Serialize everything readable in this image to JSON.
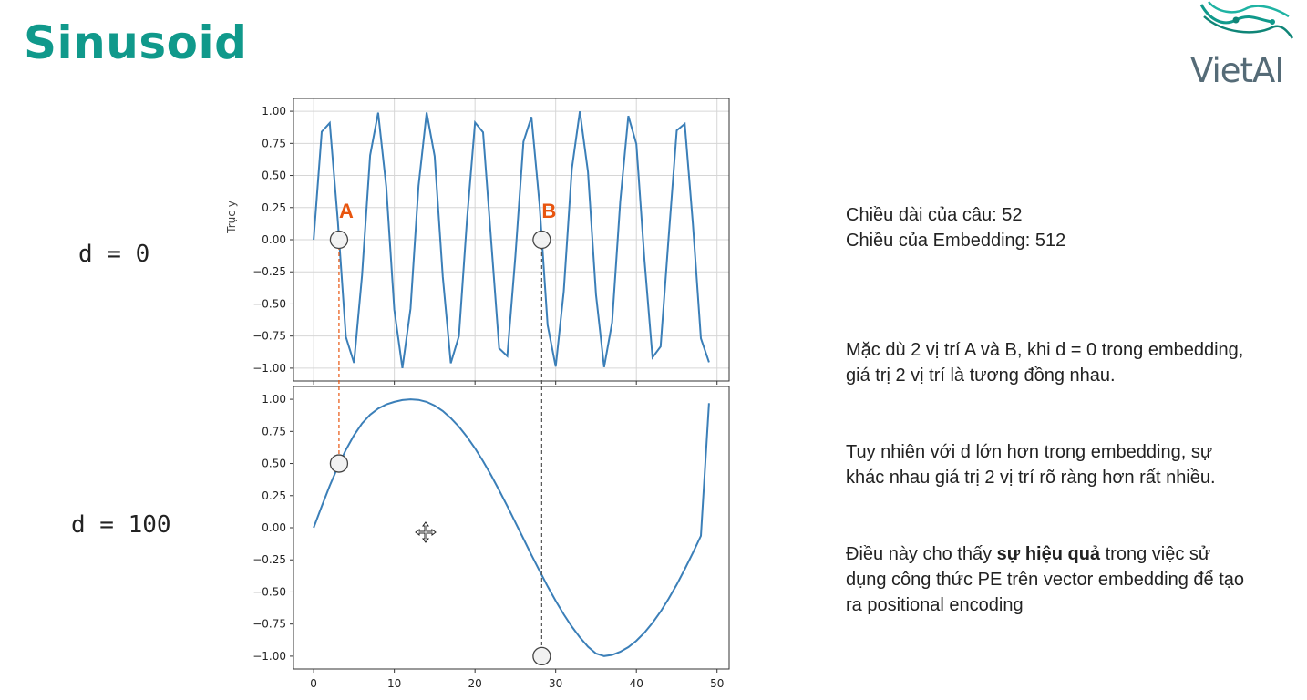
{
  "slide": {
    "title": "Sinusoid",
    "logo_text": "VietAI",
    "d_labels": [
      "d = 0",
      "d = 100"
    ],
    "accent_color": "#10998b",
    "marker_color": "#e8550f",
    "line_color": "#3b7fb8"
  },
  "info": {
    "sentence_length": "Chiều dài của câu: 52",
    "embedding_dim": "Chiều của Embedding: 512",
    "para1": "Mặc dù 2 vị trí A và B, khi d = 0 trong embedding, giá trị 2 vị trí là tương đồng nhau.",
    "para2": "Tuy nhiên với d lớn hơn trong embedding, sự khác nhau giá trị 2 vị trí rõ ràng hơn rất nhiều.",
    "para3_prefix": "Điều này cho thấy ",
    "para3_bold": "sự hiệu quả",
    "para3_suffix": " trong việc sử dụng công thức PE trên vector embedding để tạo ra positional encoding"
  },
  "chart_data": [
    {
      "type": "line",
      "title": "",
      "ylabel": "Trục y",
      "xlabel": "",
      "xlim": [
        -2.5,
        51.5
      ],
      "ylim": [
        -1.1,
        1.1
      ],
      "yticks": [
        "1.00",
        "0.75",
        "0.50",
        "0.25",
        "0.00",
        "−0.25",
        "−0.50",
        "−0.75",
        "−1.00"
      ],
      "grid": true,
      "series": [
        {
          "x": [
            0,
            1,
            2,
            3,
            4,
            5,
            6,
            7,
            8,
            9,
            10,
            11,
            12,
            13,
            14,
            15,
            16,
            17,
            18,
            19,
            20,
            21,
            22,
            23,
            24,
            25,
            26,
            27,
            28,
            29,
            30,
            31,
            32,
            33,
            34,
            35,
            36,
            37,
            38,
            39,
            40,
            41,
            42,
            43,
            44,
            45,
            46,
            47,
            48,
            49
          ],
          "values": [
            0.0,
            0.841,
            0.909,
            0.141,
            -0.757,
            -0.959,
            -0.279,
            0.657,
            0.989,
            0.412,
            -0.544,
            -1.0,
            -0.537,
            0.42,
            0.991,
            0.65,
            -0.288,
            -0.961,
            -0.751,
            0.15,
            0.913,
            0.837,
            -0.009,
            -0.846,
            -0.906,
            -0.132,
            0.763,
            0.956,
            0.271,
            -0.664,
            -0.988,
            -0.404,
            0.551,
            1.0,
            0.529,
            -0.428,
            -0.992,
            -0.644,
            0.296,
            0.964,
            0.745,
            -0.159,
            -0.917,
            -0.832,
            0.018,
            0.851,
            0.902,
            0.124,
            -0.768,
            -0.954
          ]
        }
      ],
      "annotations": [
        {
          "label": "A",
          "x": 3.14,
          "y": 0.0
        },
        {
          "label": "B",
          "x": 28.27,
          "y": 0.0
        }
      ]
    },
    {
      "type": "line",
      "title": "",
      "ylabel": "",
      "xlabel": "",
      "xlim": [
        -2.5,
        51.5
      ],
      "ylim": [
        -1.1,
        1.1
      ],
      "xticks": [
        "0",
        "10",
        "20",
        "30",
        "40",
        "50"
      ],
      "yticks": [
        "1.00",
        "0.75",
        "0.50",
        "0.25",
        "0.00",
        "−0.25",
        "−0.50",
        "−0.75",
        "−1.00"
      ],
      "grid": false,
      "series": [
        {
          "x": [
            0,
            1,
            2,
            3,
            4,
            5,
            6,
            7,
            8,
            9,
            10,
            11,
            12,
            13,
            14,
            15,
            16,
            17,
            18,
            19,
            20,
            21,
            22,
            23,
            24,
            25,
            26,
            27,
            28,
            29,
            30,
            31,
            32,
            33,
            34,
            35,
            36,
            37,
            38,
            39,
            40,
            41,
            42,
            43,
            44,
            45,
            46,
            47,
            48,
            49
          ],
          "values": [
            0.0,
            0.167,
            0.327,
            0.474,
            0.607,
            0.72,
            0.812,
            0.88,
            0.928,
            0.96,
            0.98,
            0.994,
            1.0,
            0.996,
            0.98,
            0.951,
            0.909,
            0.854,
            0.787,
            0.708,
            0.618,
            0.518,
            0.408,
            0.291,
            0.168,
            0.042,
            -0.085,
            -0.212,
            -0.336,
            -0.456,
            -0.569,
            -0.674,
            -0.77,
            -0.854,
            -0.926,
            -0.979,
            -0.999,
            -0.99,
            -0.966,
            -0.93,
            -0.88,
            -0.817,
            -0.741,
            -0.653,
            -0.553,
            -0.443,
            -0.323,
            -0.196,
            -0.063,
            0.97
          ]
        }
      ],
      "annotations": [
        {
          "label": "",
          "x": 3.14,
          "y": 0.5
        },
        {
          "label": "",
          "x": 28.27,
          "y": -1.0
        }
      ]
    }
  ]
}
